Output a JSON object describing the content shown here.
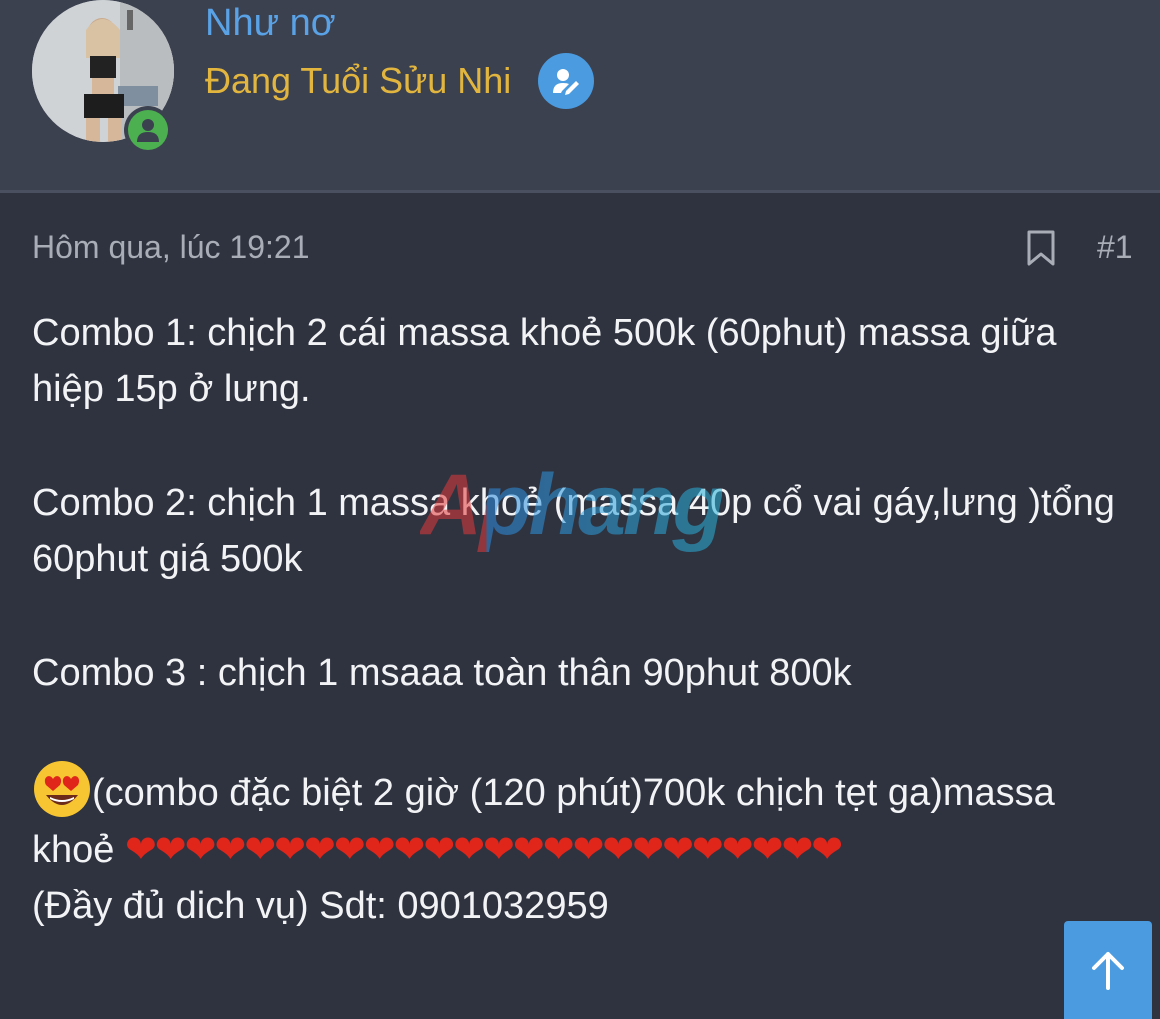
{
  "user": {
    "name": "Như nơ",
    "title": "Đang Tuổi Sửu Nhi",
    "avatar_icon": "user-photo",
    "online_icon": "person-online-icon",
    "badge_icon": "pencil-user-icon"
  },
  "post": {
    "time": "Hôm qua, lúc 19:21",
    "number": "#1",
    "bookmark_icon": "bookmark-icon",
    "lines": {
      "combo1": "Combo 1: chịch 2 cái massa khoẻ 500k (60phut) massa giữa hiệp 15p ở lưng.",
      "combo2": "Combo 2: chịch 1 massa khoẻ (massa 40p cổ vai gáy,lưng )tổng 60phut giá 500k",
      "combo3": "Combo 3 : chịch 1 msaaa toàn thân 90phut 800k",
      "special": "(combo đặc biệt 2 giờ (120 phút)700k chịch tẹt ga)massa khoẻ ",
      "hearts": "❤❤❤❤❤❤❤❤❤❤❤❤❤❤❤❤❤❤❤❤❤❤❤❤",
      "contact": "(Đầy đủ dich vụ) Sdt: 0901032959"
    },
    "emoji_icon": "heart-eyes-emoji"
  },
  "watermark": "Aphang",
  "scroll_top_icon": "arrow-up-icon",
  "colors": {
    "background": "#2f3340",
    "header": "#3c4150",
    "username": "#5aa2e6",
    "usertitle": "#e2b63e",
    "accent": "#4a9be0",
    "online": "#4caf50",
    "heart": "#e0251b"
  }
}
